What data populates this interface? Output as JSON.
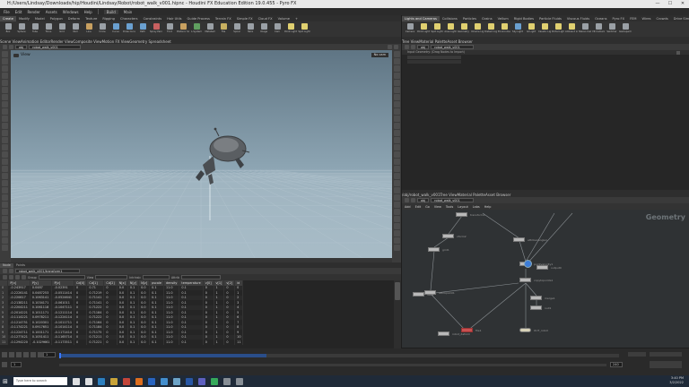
{
  "window": {
    "title": "H:/Users/Lindsay/Downloads/hip/Houdini/Lindsay/Robot/robot_walk_v001.hipnc - Houdini FX Education Edition 19.0.455 - Pyro FX"
  },
  "menubar": {
    "items": [
      "File",
      "Edit",
      "Render",
      "Assets",
      "Windows",
      "Help"
    ],
    "desktop": "Build",
    "main_label": "Main"
  },
  "shelf_tabs": [
    "Create",
    "Modify",
    "Model",
    "Polygon",
    "Deform",
    "Texture",
    "Rigging",
    "Characters",
    "Constraints",
    "Hair Utils",
    "Guide Process",
    "Terrain FX",
    "Simple FX",
    "Cloud FX",
    "Volume",
    "+"
  ],
  "shelf_tools": [
    {
      "label": "Box",
      "color": "#9aa0a6"
    },
    {
      "label": "Sphere",
      "color": "#9aa0a6"
    },
    {
      "label": "Tube",
      "color": "#9aa0a6"
    },
    {
      "label": "Torus",
      "color": "#9aa0a6"
    },
    {
      "label": "Grid",
      "color": "#9aa0a6"
    },
    {
      "label": "Null",
      "color": "#9aa0a6"
    },
    {
      "label": "Line",
      "color": "#c8a060"
    },
    {
      "label": "Circle",
      "color": "#9aa0a6"
    },
    {
      "label": "Curve",
      "color": "#6aa0d0"
    },
    {
      "label": "Draw Curve",
      "color": "#6aa0d0"
    },
    {
      "label": "Path",
      "color": "#6aa0d0"
    },
    {
      "label": "Spray Paint",
      "color": "#c86060"
    },
    {
      "label": "Font",
      "color": "#9aa0a6"
    },
    {
      "label": "Platonic Solids",
      "color": "#c8a060"
    },
    {
      "label": "L-System",
      "color": "#60a060"
    },
    {
      "label": "Metaball",
      "color": "#9aa0a6"
    },
    {
      "label": "File",
      "color": "#c8b060"
    },
    {
      "label": "Spiral",
      "color": "#9aa0a6"
    },
    {
      "label": "Helix",
      "color": "#9aa0a6"
    },
    {
      "label": "Image",
      "color": "#9aa0a6"
    },
    {
      "label": "Cam",
      "color": "#9aa0a6"
    },
    {
      "label": "Point Light",
      "color": "#e0d070"
    },
    {
      "label": "Spot Light",
      "color": "#e0d070"
    }
  ],
  "right_shelf_tabs": [
    "Lights and Cameras",
    "Collisions",
    "Particles",
    "Grains",
    "Vellum",
    "Rigid Bodies",
    "Particle Fluids",
    "Viscous Fluids",
    "Oceans",
    "Pyro FX",
    "FEM",
    "Wires",
    "Crowds",
    "Drive Simulation"
  ],
  "right_shelf_tools": [
    {
      "label": "Camera",
      "color": "#9aa0a6"
    },
    {
      "label": "Point Light",
      "color": "#e0d070"
    },
    {
      "label": "Spot Light",
      "color": "#e0d070"
    },
    {
      "label": "Area Light",
      "color": "#e0d070"
    },
    {
      "label": "Geometry Light",
      "color": "#e0d070"
    },
    {
      "label": "Volume Light",
      "color": "#e0d070"
    },
    {
      "label": "Distant Light",
      "color": "#e0d070"
    },
    {
      "label": "Environment Light",
      "color": "#e0d070"
    },
    {
      "label": "Sky Light",
      "color": "#6aa0d0"
    },
    {
      "label": "GI Light",
      "color": "#e0d070"
    },
    {
      "label": "Caustic Light",
      "color": "#e0d070"
    },
    {
      "label": "Portal Light",
      "color": "#e0d070"
    },
    {
      "label": "Ambient Light",
      "color": "#e0d070"
    },
    {
      "label": "Stereo Camera",
      "color": "#9aa0a6"
    },
    {
      "label": "VR Camera",
      "color": "#9aa0a6"
    },
    {
      "label": "Switcher",
      "color": "#9aa0a6"
    },
    {
      "label": "Gamepad Camera",
      "color": "#9aa0a6"
    }
  ],
  "viewport": {
    "tabs": [
      "Scene View",
      "Animation Editor",
      "Render View",
      "Composite View",
      "Motion FX View",
      "Geometry Spreadsheet"
    ],
    "path": "obj",
    "node": "robot_walk_v001",
    "label": "View",
    "camera": "No cam",
    "active_tab": 0
  },
  "right_top": {
    "tabs": [
      "Tree View",
      "Material Palette",
      "Asset Browser"
    ],
    "path": "obj",
    "node": "robot_walk_v001",
    "label": "Input Geometry: (Drag Nodes to Import)"
  },
  "network": {
    "tabs": [
      "/obj/robot_walk_v001",
      "Tree View",
      "Material Palette",
      "Asset Browser"
    ],
    "path": "obj",
    "node": "robot_walk_v001",
    "menu": [
      "Add",
      "Edit",
      "Go",
      "View",
      "Tools",
      "Layout",
      "Labs",
      "Help"
    ],
    "context": "Geometry",
    "nodes": [
      {
        "label": "transform1"
      },
      {
        "label": "attribwrangle1"
      },
      {
        "label": "xform2"
      },
      {
        "label": "pointvelocity1"
      },
      {
        "label": "grid1"
      },
      {
        "label": "attribpaint1"
      },
      {
        "label": "copytopoints1"
      },
      {
        "label": "merge1"
      },
      {
        "label": "file1"
      },
      {
        "label": "null1"
      },
      {
        "label": "OUT_robot"
      },
      {
        "label": "rest1"
      },
      {
        "label": "output0"
      },
      {
        "label": "robot_deform"
      }
    ]
  },
  "spreadsheet": {
    "tabs": [
      "Node",
      "Points"
    ],
    "node": "robot_walk_v001/transform1",
    "group_label": "Group",
    "view_label": "View",
    "intrinsic_label": "Intrinsic",
    "attrib_label": "Attrib",
    "columns": [
      "",
      "P[x]",
      "P[y]",
      "P[z]",
      "Cd[0]",
      "Cd[1]",
      "Cd[2]",
      "N[x]",
      "N[y]",
      "N[z]",
      "pscale",
      "density",
      "temperature",
      "v[0]",
      "v[1]",
      "v[2]",
      "id"
    ],
    "rows": [
      [
        "0",
        "-0.243917",
        "0.0487",
        "-0.02391",
        "0",
        "0.71",
        "0",
        "0.0",
        "0.1",
        "0.0",
        "0.1",
        "11.0",
        "0.1",
        "0",
        "1",
        "0",
        "0"
      ],
      [
        "1",
        "-0.2226141",
        "0.0487253",
        "-0.0511414",
        "0",
        "0.71219",
        "0",
        "0.0",
        "0.1",
        "0.0",
        "0.1",
        "11.0",
        "0.1",
        "0",
        "1",
        "0",
        "1"
      ],
      [
        "2",
        "-0.220617",
        "0.1063141",
        "-0.0524641",
        "0",
        "0.71141",
        "0",
        "0.0",
        "0.1",
        "0.0",
        "0.1",
        "11.0",
        "0.1",
        "0",
        "1",
        "0",
        "2"
      ],
      [
        "3",
        "-0.2138211",
        "0.1034171",
        "-0.061011",
        "0",
        "0.71141",
        "0",
        "0.0",
        "0.1",
        "0.0",
        "0.1",
        "11.0",
        "0.1",
        "0",
        "1",
        "0",
        "3"
      ],
      [
        "4",
        "-0.2204211",
        "0.1061118",
        "-0.1047111",
        "0",
        "0.71222",
        "0",
        "0.0",
        "0.1",
        "0.0",
        "0.1",
        "11.0",
        "0.1",
        "0",
        "1",
        "0",
        "4"
      ],
      [
        "5",
        "-0.2014221",
        "0.1011171",
        "-0.1211114",
        "0",
        "0.71184",
        "0",
        "0.0",
        "0.1",
        "0.0",
        "0.1",
        "11.0",
        "0.1",
        "0",
        "1",
        "0",
        "5"
      ],
      [
        "6",
        "-0.1114221",
        "0.0978211",
        "-0.1224114",
        "0",
        "0.71222",
        "0",
        "0.0",
        "0.1",
        "0.0",
        "0.1",
        "11.0",
        "0.1",
        "0",
        "1",
        "0",
        "6"
      ],
      [
        "7",
        "-0.1214751",
        "0.1020301",
        "-0.1011711",
        "0",
        "0.71164",
        "0",
        "0.0",
        "0.1",
        "0.0",
        "0.1",
        "11.0",
        "0.1",
        "0",
        "1",
        "0",
        "7"
      ],
      [
        "8",
        "-0.1174221",
        "0.0917651",
        "-0.1014114",
        "0",
        "0.71184",
        "0",
        "0.0",
        "0.1",
        "0.0",
        "0.1",
        "11.0",
        "0.1",
        "0",
        "1",
        "0",
        "8"
      ],
      [
        "9",
        "-0.1224711",
        "0.1001171",
        "-0.1171414",
        "0",
        "0.71175",
        "0",
        "0.0",
        "0.1",
        "0.0",
        "0.1",
        "11.0",
        "0.1",
        "0",
        "1",
        "0",
        "9"
      ],
      [
        "10",
        "-0.1277421",
        "0.1051411",
        "-0.1165714",
        "0",
        "0.71211",
        "0",
        "0.0",
        "0.1",
        "0.0",
        "0.1",
        "11.0",
        "0.1",
        "0",
        "1",
        "0",
        "10"
      ],
      [
        "11",
        "-0.1294220",
        "-0.1029661",
        "-0.1173511",
        "0",
        "0.71221",
        "0",
        "0.0",
        "0.1",
        "0.0",
        "0.1",
        "11.0",
        "0.1",
        "0",
        "1",
        "0",
        "11"
      ]
    ]
  },
  "timeline": {
    "frame": "1",
    "start": "1",
    "end": "240",
    "frame_label": "1",
    "range_start": "1",
    "range_end": "240"
  },
  "taskbar": {
    "search_placeholder": "Type here to search",
    "icons": [
      {
        "name": "cortana-icon",
        "color": "#ffffff"
      },
      {
        "name": "taskview-icon",
        "color": "#ffffff"
      },
      {
        "name": "edge-icon",
        "color": "#2f8fd8"
      },
      {
        "name": "explorer-icon",
        "color": "#e6b83a"
      },
      {
        "name": "chrome-icon",
        "color": "#e04a3a"
      },
      {
        "name": "houdini-icon",
        "color": "#ff7a1a"
      },
      {
        "name": "photoshop-icon",
        "color": "#2a6fd8"
      },
      {
        "name": "mail-icon",
        "color": "#4aa0e8"
      },
      {
        "name": "store-icon",
        "color": "#7ab8e0"
      },
      {
        "name": "word-icon",
        "color": "#2a5fb8"
      },
      {
        "name": "teams-icon",
        "color": "#6a6ad8"
      },
      {
        "name": "spotify-icon",
        "color": "#3ac060"
      },
      {
        "name": "steam-icon",
        "color": "#9aa0a6"
      },
      {
        "name": "download-icon",
        "color": "#9aa0a6"
      }
    ],
    "clock": "3:40 PM",
    "date": "3/2/2022"
  }
}
